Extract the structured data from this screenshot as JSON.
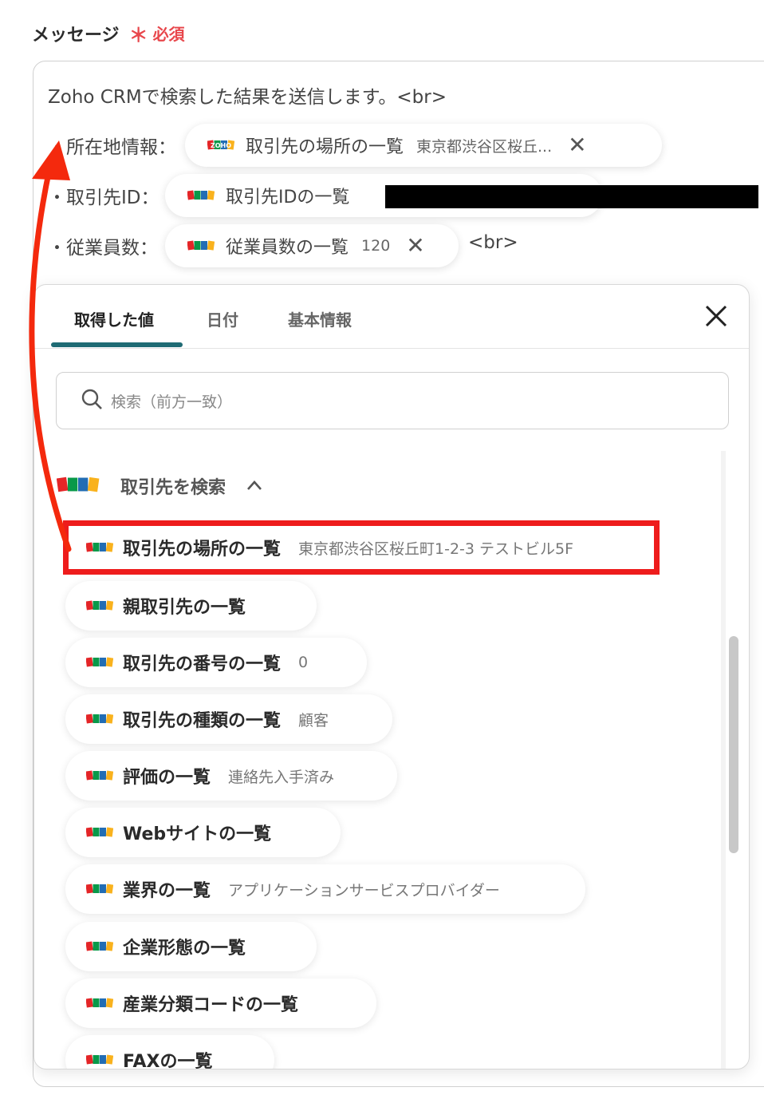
{
  "field": {
    "label": "メッセージ",
    "required_star": "＊",
    "required_text": "必須"
  },
  "message": {
    "first_line": "Zoho CRMで検索した結果を送信します。<br>",
    "rows": [
      {
        "label": "・所在地情報：",
        "pill_label": "取引先の場所の一覧",
        "pill_value": "東京都渋谷区桜丘...",
        "pill_close": "✕"
      },
      {
        "label": "・取引先ID：",
        "pill_label": "取引先IDの一覧",
        "pill_value": ""
      },
      {
        "label": "・従業員数：",
        "pill_label": "従業員数の一覧",
        "pill_value": "120",
        "pill_close": "✕",
        "trailing": "<br>"
      }
    ]
  },
  "panel": {
    "tabs": [
      {
        "label": "取得した値"
      },
      {
        "label": "日付"
      },
      {
        "label": "基本情報"
      }
    ],
    "search_placeholder": "検索（前方一致）",
    "group_title": "取引先を検索",
    "items": [
      {
        "label": "取引先の場所の一覧",
        "value": "東京都渋谷区桜丘町1-2-3 テストビル5F"
      },
      {
        "label": "親取引先の一覧",
        "value": ""
      },
      {
        "label": "取引先の番号の一覧",
        "value": "0"
      },
      {
        "label": "取引先の種類の一覧",
        "value": "顧客"
      },
      {
        "label": "評価の一覧",
        "value": "連絡先入手済み"
      },
      {
        "label": "Webサイトの一覧",
        "value": ""
      },
      {
        "label": "業界の一覧",
        "value": "アプリケーションサービスプロバイダー"
      },
      {
        "label": "企業形態の一覧",
        "value": ""
      },
      {
        "label": "産業分類コードの一覧",
        "value": ""
      },
      {
        "label": "FAXの一覧",
        "value": ""
      }
    ]
  },
  "colors": {
    "accent": "#1f6b74",
    "required": "#e8474c",
    "highlight": "#ee1c1c",
    "arrow": "#f4290d"
  },
  "icons": {
    "brand": "zoho-logo-icon",
    "close": "close-icon",
    "search": "search-icon",
    "chevron": "chevron-up-icon"
  },
  "zoho_text": "ZOHO"
}
